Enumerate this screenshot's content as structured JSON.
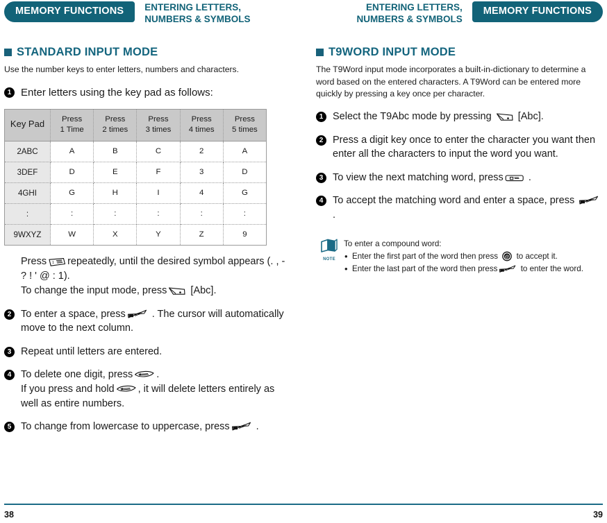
{
  "left_page": {
    "running_head": {
      "tab_label": "MEMORY FUNCTIONS",
      "section_label": "ENTERING LETTERS,\nNUMBERS & SYMBOLS"
    },
    "heading": "STANDARD INPUT MODE",
    "lead": "Use the number keys to enter letters, numbers and characters.",
    "steps": [
      {
        "num": "1",
        "text": "Enter letters using the key pad as follows:"
      },
      {
        "num": "2",
        "text_before": "To enter a space, press",
        "text_after": ". The cursor will automatically move to the next column.",
        "icon": "send-key-icon"
      },
      {
        "num": "3",
        "text": "Repeat until letters are entered."
      },
      {
        "num": "4",
        "line1_before": "To delete one digit, press",
        "line1_after": ".",
        "line2_before": "If you press and hold",
        "line2_after": ", it will delete letters entirely as well as entire numbers.",
        "icon": "clear-key-icon"
      },
      {
        "num": "5",
        "text_before": "To change from lowercase to uppercase, press",
        "text_after": ".",
        "icon": "send-key-icon"
      }
    ],
    "after_table": {
      "line1_before": "Press",
      "line1_after": "repeatedly, until the desired symbol appears (. , - ? ! ' @ : 1).",
      "line1_icon": "one-key-icon",
      "line2_before": "To change the input mode, press",
      "line2_after": "[Abc].",
      "line2_icon": "soft-key-icon"
    },
    "table": {
      "headers": [
        "Key Pad",
        "Press\n1 Time",
        "Press\n2 times",
        "Press\n3 times",
        "Press\n4 times",
        "Press\n5 times"
      ],
      "rows": [
        [
          "2ABC",
          "A",
          "B",
          "C",
          "2",
          "A"
        ],
        [
          "3DEF",
          "D",
          "E",
          "F",
          "3",
          "D"
        ],
        [
          "4GHI",
          "G",
          "H",
          "I",
          "4",
          "G"
        ],
        [
          ":",
          ":",
          ":",
          ":",
          ":",
          ":"
        ],
        [
          "9WXYZ",
          "W",
          "X",
          "Y",
          "Z",
          "9"
        ]
      ]
    },
    "folio": "38"
  },
  "right_page": {
    "running_head": {
      "tab_label": "MEMORY FUNCTIONS",
      "section_label": "ENTERING LETTERS,\nNUMBERS & SYMBOLS"
    },
    "heading": "T9WORD INPUT MODE",
    "lead": "The T9Word input mode incorporates a built-in-dictionary to determine a word based on the entered characters. A T9Word can be entered more quickly by pressing a key once per character.",
    "steps": [
      {
        "num": "1",
        "text_before": "Select the T9Abc mode by pressing",
        "text_after": "[Abc].",
        "icon": "soft-key-icon"
      },
      {
        "num": "2",
        "text": "Press a digit key once to enter the character you want then enter all the characters to input the word you want."
      },
      {
        "num": "3",
        "text_before": "To view the next matching word, press",
        "text_after": ".",
        "icon": "zero-key-icon"
      },
      {
        "num": "4",
        "text_before": "To accept the matching word and enter a space, press",
        "text_after": ".",
        "icon": "send-key-icon"
      }
    ],
    "note": {
      "label": "NOTE",
      "title": "To enter a compound word:",
      "items": [
        {
          "before": "Enter the first part of the word then press",
          "after": "to accept it.",
          "icon": "at-key-icon"
        },
        {
          "before": "Enter the last part of the word then press",
          "after": "to enter the word.",
          "icon": "send-key-icon"
        }
      ]
    },
    "folio": "39"
  },
  "colors": {
    "brand_teal": "#126378",
    "heading_teal": "#14657e",
    "table_header_gray": "#c9c9c9",
    "table_rowhead_gray": "#e8e8e8"
  }
}
